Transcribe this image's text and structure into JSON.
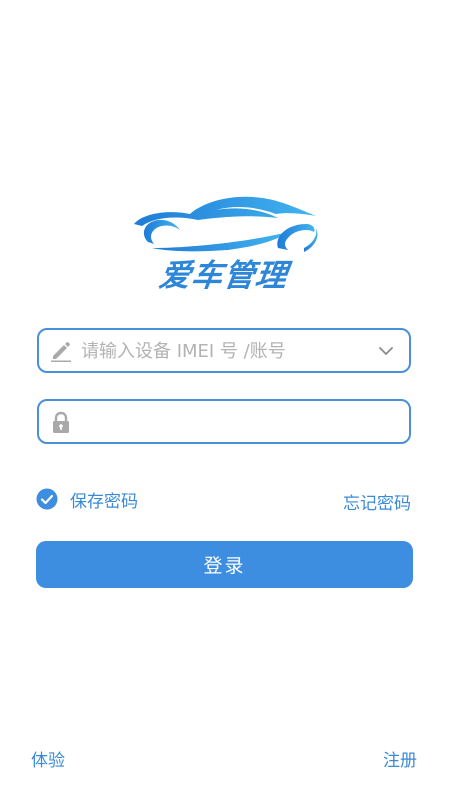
{
  "logo": {
    "text": "爱车管理",
    "icon": "car-logo-icon",
    "color": "#2e86d8"
  },
  "form": {
    "account": {
      "placeholder": "请输入设备 IMEI 号 /账号",
      "value": "",
      "leading_icon": "pencil-icon",
      "trailing_icon": "chevron-down-icon"
    },
    "password": {
      "placeholder": "",
      "value": "",
      "leading_icon": "lock-icon"
    },
    "remember": {
      "label": "保存密码",
      "checked": true,
      "icon": "check-circle-icon"
    },
    "forgot_label": "忘记密码",
    "login_label": "登录"
  },
  "footer": {
    "trial_label": "体验",
    "register_label": "注册"
  },
  "colors": {
    "accent": "#3d8de0",
    "border": "#4a90d9",
    "placeholder": "#b3b3b3"
  }
}
